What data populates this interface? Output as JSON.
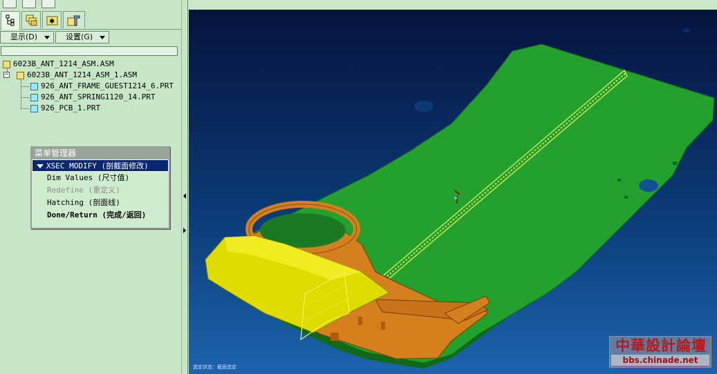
{
  "toolbar": {
    "icons": [
      "sketch-icon",
      "edit-icon",
      "redo-icon"
    ]
  },
  "tabs": [
    {
      "icon": "model-tree-icon",
      "active": true
    },
    {
      "icon": "layers-icon",
      "active": false
    },
    {
      "icon": "favorites-icon",
      "active": false
    },
    {
      "icon": "tools-icon",
      "active": false
    }
  ],
  "menus": {
    "show_label": "显示(D)",
    "settings_label": "设置(G)"
  },
  "filter": {
    "value": ""
  },
  "tree": {
    "items": [
      {
        "label": "6023B_ANT_1214_ASM.ASM",
        "type": "asm"
      },
      {
        "label": "6023B_ANT_1214_ASM_1.ASM",
        "type": "asm",
        "expander": "−"
      },
      {
        "label": "926_ANT_FRAME_GUEST1214_6.PRT",
        "type": "prt"
      },
      {
        "label": "926_ANT_SPRING1120_14.PRT",
        "type": "prt"
      },
      {
        "label": "926_PCB_1.PRT",
        "type": "prt"
      }
    ]
  },
  "menu_manager": {
    "title": "菜单管理器",
    "header": "XSEC MODIFY (剖截面修改)",
    "items": [
      {
        "label": "Dim Values (尺寸值)",
        "state": "normal"
      },
      {
        "label": "Redefine (重定义)",
        "state": "disabled"
      },
      {
        "label": "Hatching (剖面线)",
        "state": "normal"
      },
      {
        "label": "Done/Return (完成/返回)",
        "state": "bold"
      }
    ]
  },
  "viewport": {
    "status_line1": "选定状态：截面选定",
    "status_line2": "",
    "colors": {
      "pcb": "#22a12c",
      "frame": "#d4801e",
      "cover": "#e0dc00",
      "hatch": "#f2f060"
    }
  },
  "watermark": {
    "cn": "中華設計論壇",
    "url": "bbs.chinade.net"
  }
}
